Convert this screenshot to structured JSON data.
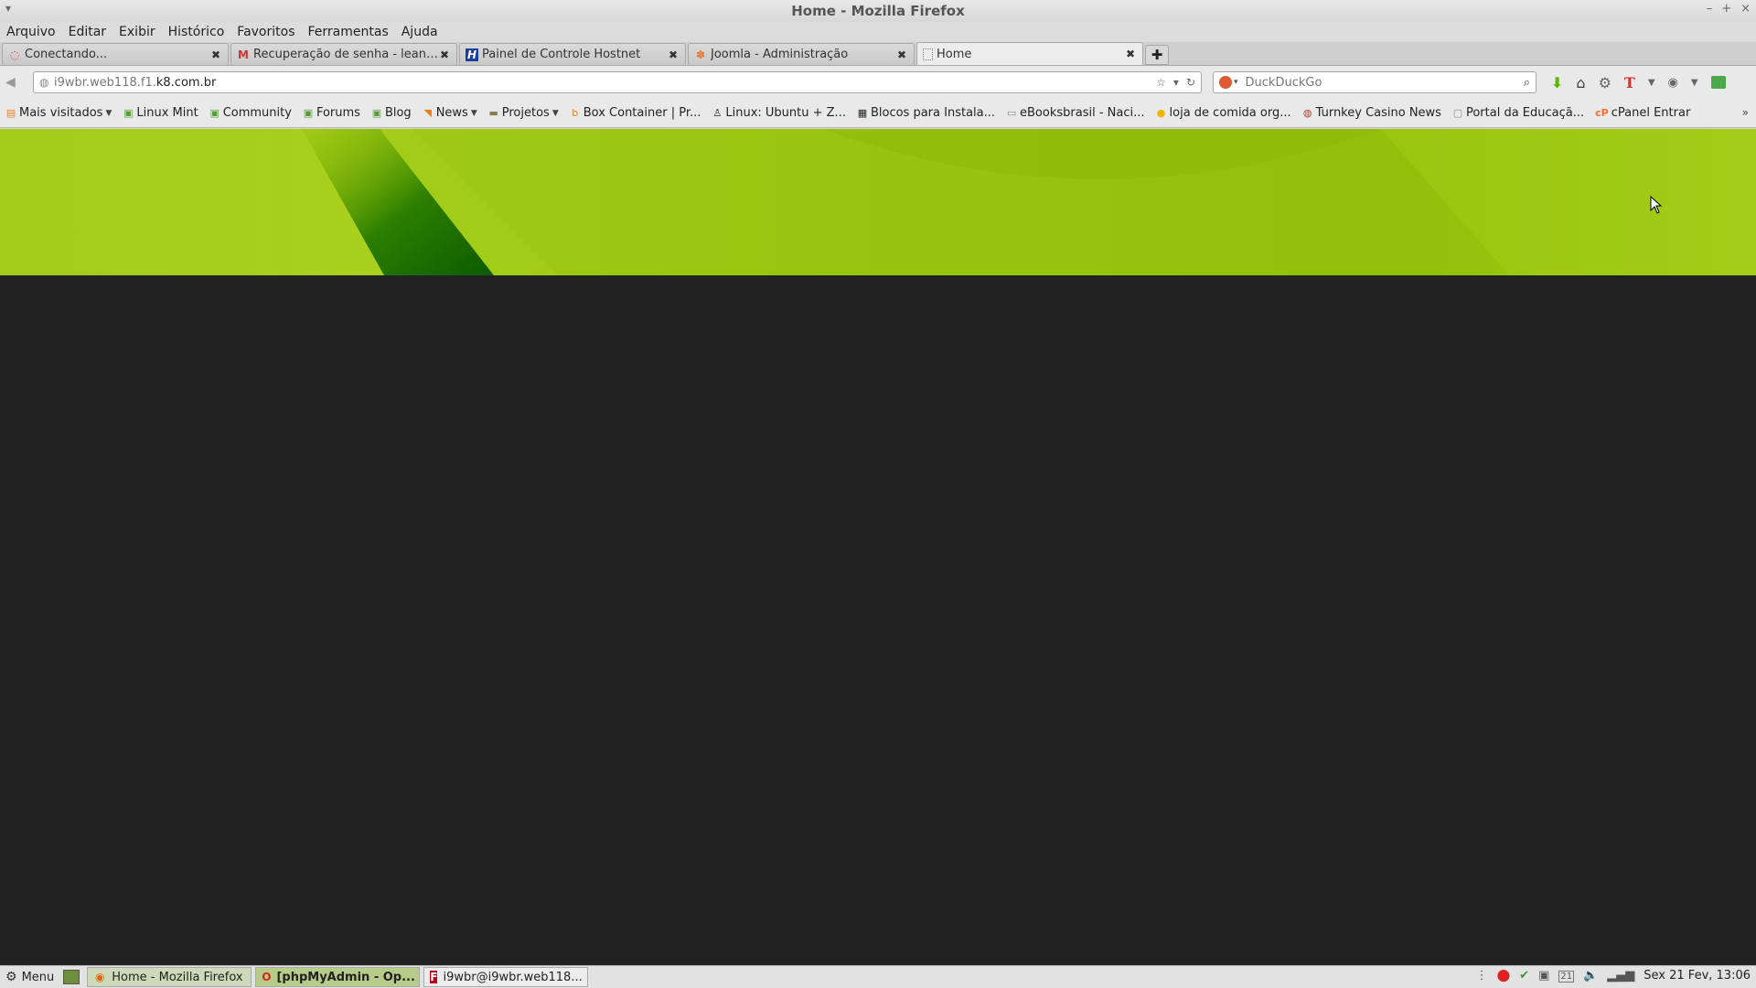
{
  "window": {
    "title": "Home - Mozilla Firefox",
    "controls": [
      "–",
      "+",
      "×"
    ]
  },
  "menubar": [
    "Arquivo",
    "Editar",
    "Exibir",
    "Histórico",
    "Favoritos",
    "Ferramentas",
    "Ajuda"
  ],
  "tabs": [
    {
      "label": "Conectando...",
      "icon": "loading-icon"
    },
    {
      "label": "Recuperação de senha - leandr...",
      "icon": "gmail-icon"
    },
    {
      "label": "Painel de Controle Hostnet",
      "icon": "hostnet-icon"
    },
    {
      "label": "Joomla - Administração",
      "icon": "joomla-icon"
    },
    {
      "label": "Home",
      "icon": "blank-page-icon"
    }
  ],
  "navbar": {
    "url_prefix": "i9wbr.web118.f1.",
    "url_domain": "k8.com.br",
    "search_placeholder": "DuckDuckGo"
  },
  "bookmarks": [
    {
      "label": "Mais visitados",
      "icon": "most-visited-icon",
      "dropdown": true
    },
    {
      "label": "Linux Mint",
      "icon": "mint-icon"
    },
    {
      "label": "Community",
      "icon": "mint-icon"
    },
    {
      "label": "Forums",
      "icon": "mint-icon"
    },
    {
      "label": "Blog",
      "icon": "mint-icon"
    },
    {
      "label": "News",
      "icon": "rss-icon",
      "dropdown": true
    },
    {
      "label": "Projetos",
      "icon": "folder-icon",
      "dropdown": true
    },
    {
      "label": "Box Container | Pr...",
      "icon": "blogger-icon"
    },
    {
      "label": "Linux: Ubuntu + Z...",
      "icon": "tux-icon"
    },
    {
      "label": "Blocos para Instala...",
      "icon": "blocks-icon"
    },
    {
      "label": "eBooksbrasil - Naci...",
      "icon": "ebooks-icon"
    },
    {
      "label": "loja de comida org...",
      "icon": "shop-icon"
    },
    {
      "label": "Turnkey Casino News",
      "icon": "casino-icon"
    },
    {
      "label": "Portal da Educaçã...",
      "icon": "blank-page-icon"
    },
    {
      "label": "cPanel Entrar",
      "icon": "cpanel-icon"
    }
  ],
  "taskbar": {
    "menu_label": "Menu",
    "tasks": [
      {
        "label": "Home - Mozilla Firefox",
        "icon": "firefox-icon"
      },
      {
        "label": "[phpMyAdmin - Op...",
        "icon": "opera-icon"
      },
      {
        "label": "i9wbr@i9wbr.web118...",
        "icon": "filezilla-icon"
      }
    ],
    "tray_date_badge": "21",
    "clock": "Sex 21 Fev, 13:06"
  },
  "colors": {
    "page_background": "#222222",
    "banner_green": "#9ac611",
    "banner_dark_green": "#1f6e00"
  }
}
